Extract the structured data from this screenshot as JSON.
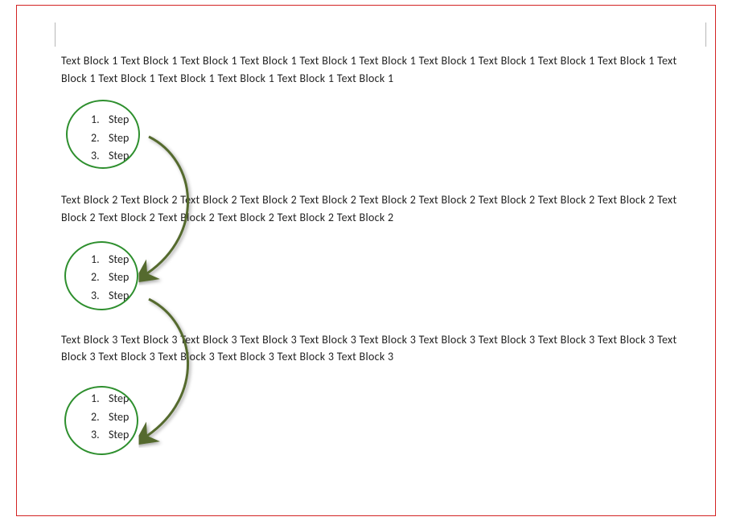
{
  "colors": {
    "border": "#d22323",
    "annotation": "#2e8f2e",
    "arrow": "#556b2f"
  },
  "blocks": [
    {
      "paragraph": "Text Block 1 Text Block 1 Text Block 1 Text Block 1 Text Block 1 Text Block 1 Text Block 1 Text Block 1 Text Block 1 Text Block 1 Text Block 1 Text Block 1 Text Block 1 Text Block 1 Text Block 1 Text Block 1",
      "steps": [
        {
          "num": "1.",
          "label": "Step"
        },
        {
          "num": "2.",
          "label": "Step"
        },
        {
          "num": "3.",
          "label": "Step"
        }
      ]
    },
    {
      "paragraph": "Text Block 2 Text Block 2 Text Block 2 Text Block 2 Text Block 2 Text Block 2 Text Block 2 Text Block 2 Text Block 2 Text Block 2 Text Block 2 Text Block 2 Text Block 2 Text Block 2 Text Block 2 Text Block 2",
      "steps": [
        {
          "num": "1.",
          "label": "Step"
        },
        {
          "num": "2.",
          "label": "Step"
        },
        {
          "num": "3.",
          "label": "Step"
        }
      ]
    },
    {
      "paragraph": "Text Block 3 Text Block 3 Text Block 3 Text Block 3 Text Block 3 Text Block 3 Text Block 3 Text Block 3 Text Block 3 Text Block 3 Text Block 3 Text Block 3 Text Block 3 Text Block 3 Text Block 3 Text Block 3",
      "steps": [
        {
          "num": "1.",
          "label": "Step"
        },
        {
          "num": "2.",
          "label": "Step"
        },
        {
          "num": "3.",
          "label": "Step"
        }
      ]
    }
  ]
}
